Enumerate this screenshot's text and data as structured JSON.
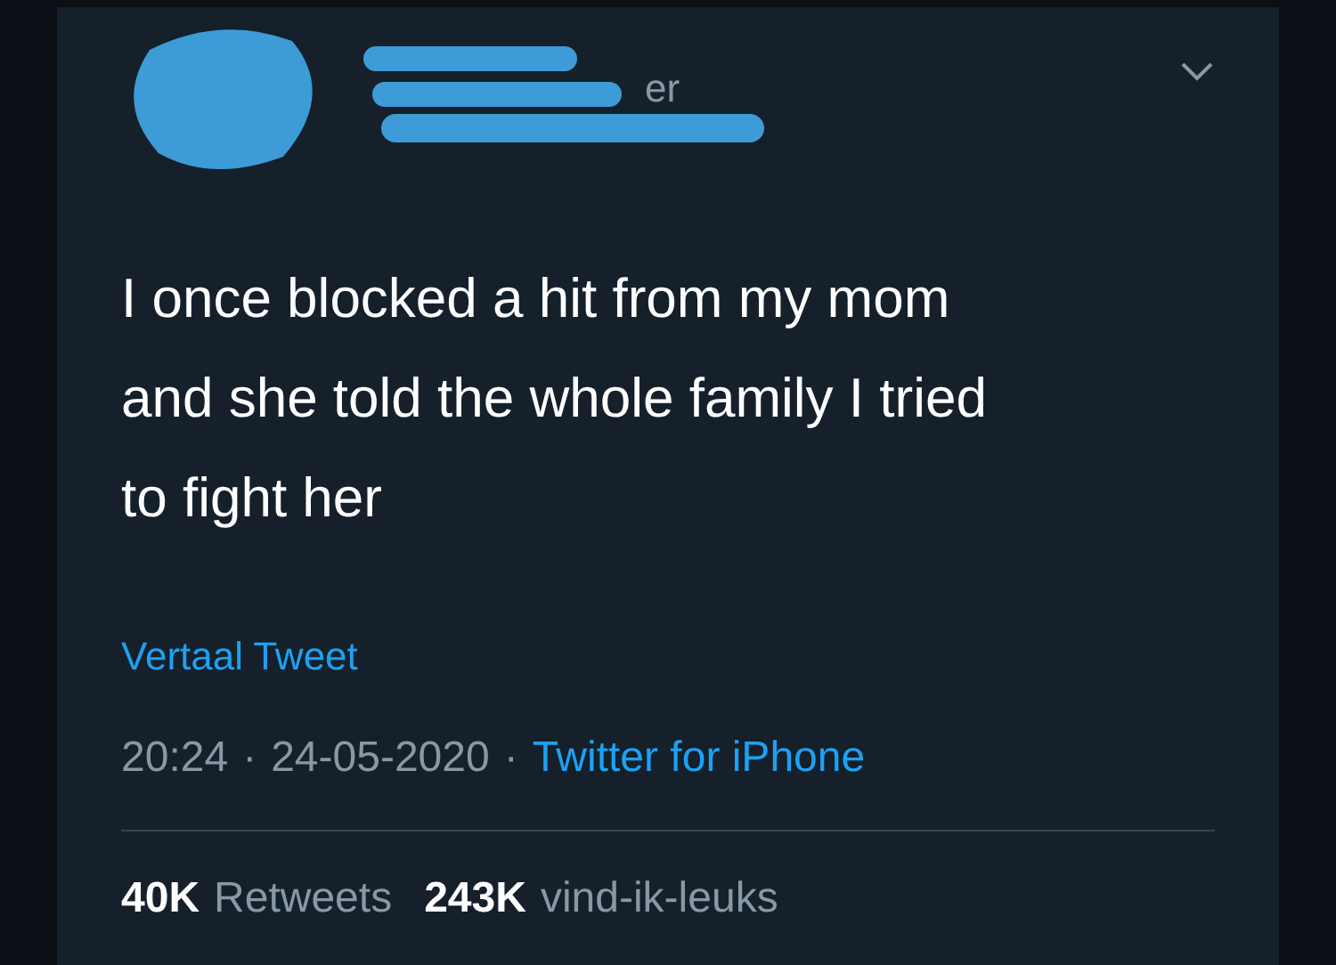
{
  "tweet": {
    "handle_fragment": "er",
    "text_lines": [
      "I once blocked a hit from my mom",
      "and she told the whole family I tried",
      "to fight her"
    ],
    "translate": "Vertaal Tweet",
    "time": "20:24",
    "separator_1": "·",
    "date": "24-05-2020",
    "separator_2": "·",
    "source": "Twitter for iPhone",
    "stats": [
      {
        "count": "40K",
        "label": "Retweets"
      },
      {
        "count": "243K",
        "label": "vind-ik-leuks"
      }
    ]
  }
}
